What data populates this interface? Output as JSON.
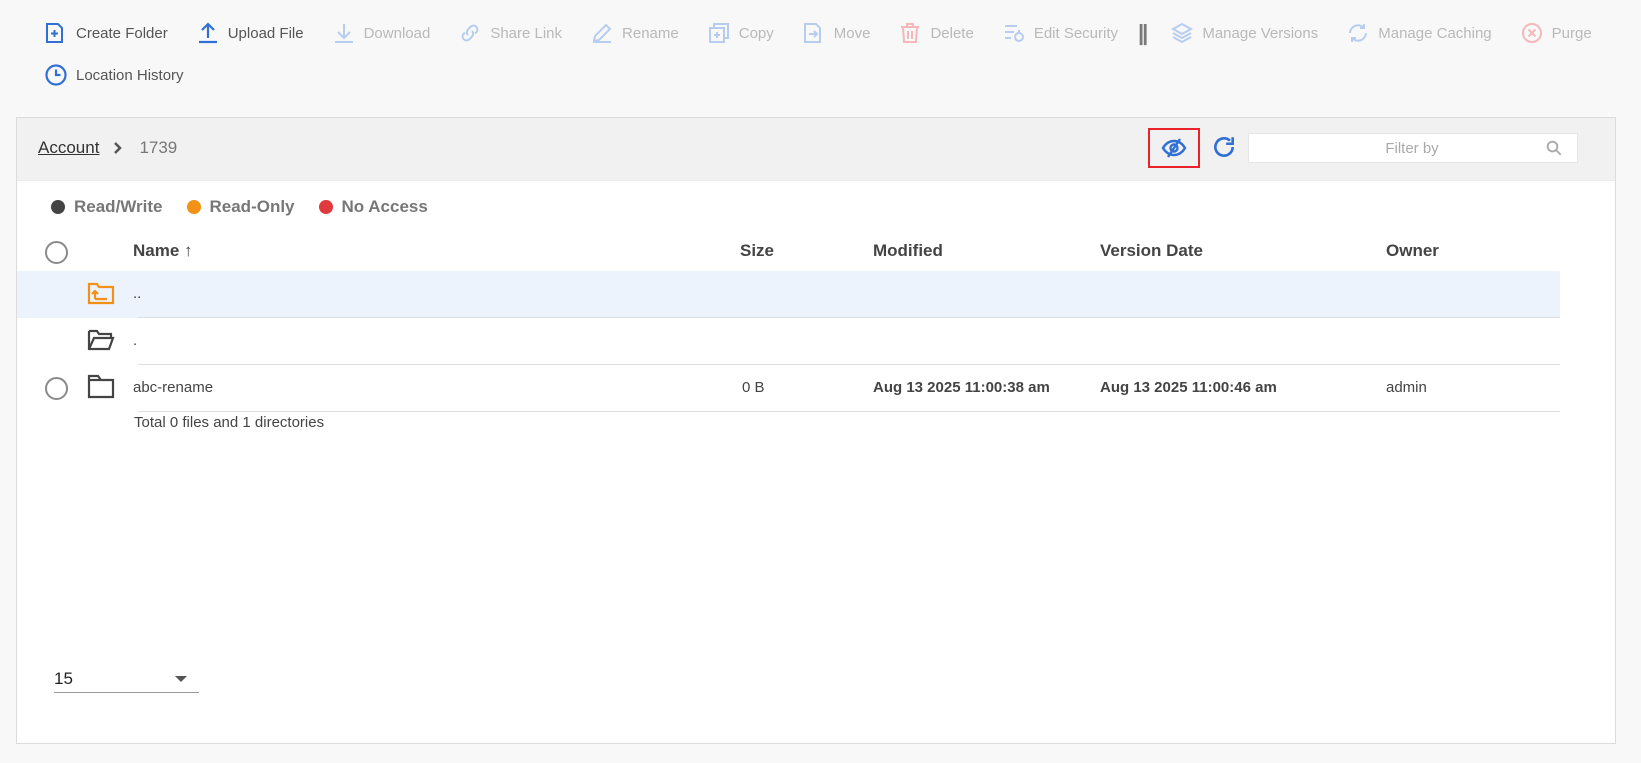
{
  "toolbar": {
    "items": [
      {
        "label": "Create Folder",
        "icon": "create-folder-icon",
        "disabled": false
      },
      {
        "label": "Upload File",
        "icon": "upload-icon",
        "disabled": false
      },
      {
        "label": "Download",
        "icon": "download-icon",
        "disabled": true
      },
      {
        "label": "Share Link",
        "icon": "link-icon",
        "disabled": true
      },
      {
        "label": "Rename",
        "icon": "pencil-icon",
        "disabled": true
      },
      {
        "label": "Copy",
        "icon": "copy-icon",
        "disabled": true
      },
      {
        "label": "Move",
        "icon": "move-icon",
        "disabled": true
      },
      {
        "label": "Delete",
        "icon": "trash-icon",
        "disabled": true
      },
      {
        "label": "Edit Security",
        "icon": "security-icon",
        "disabled": true
      },
      {
        "label": "Manage Versions",
        "icon": "layers-icon",
        "disabled": true
      },
      {
        "label": "Manage Caching",
        "icon": "cache-icon",
        "disabled": true
      },
      {
        "label": "Purge",
        "icon": "purge-icon",
        "disabled": true
      },
      {
        "label": "Location History",
        "icon": "clock-icon",
        "disabled": false
      }
    ],
    "separator": "||"
  },
  "breadcrumb": {
    "root": "Account",
    "current": "1739"
  },
  "filter": {
    "placeholder": "Filter by",
    "value": ""
  },
  "legend": [
    {
      "label": "Read/Write",
      "color": "#444444"
    },
    {
      "label": "Read-Only",
      "color": "#f39016"
    },
    {
      "label": "No Access",
      "color": "#e0393e"
    }
  ],
  "table": {
    "headers": {
      "name": "Name",
      "sort_indicator": "↑",
      "size": "Size",
      "modified": "Modified",
      "version_date": "Version Date",
      "owner": "Owner"
    },
    "rows": [
      {
        "name": "..",
        "size": "",
        "modified": "",
        "version_date": "",
        "owner": "",
        "icon": "parent-folder-icon"
      },
      {
        "name": ".",
        "size": "",
        "modified": "",
        "version_date": "",
        "owner": "",
        "icon": "open-folder-icon"
      },
      {
        "name": "abc-rename",
        "size": "0 B",
        "modified": "Aug 13 2025 11:00:38 am",
        "version_date": "Aug 13 2025 11:00:46 am",
        "owner": "admin",
        "icon": "folder-icon"
      }
    ],
    "summary": "Total 0 files and 1 directories"
  },
  "pagination": {
    "page_size": "15"
  },
  "colors": {
    "accent": "#2f6fd6",
    "warning": "#f39016",
    "danger": "#e0393e",
    "highlight_border": "#e8242a"
  }
}
